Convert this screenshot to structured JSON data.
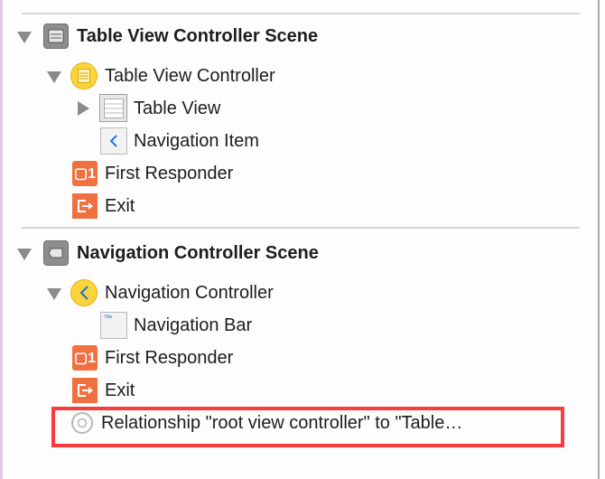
{
  "outline": {
    "scenes": [
      {
        "title": "Table View Controller Scene",
        "items": [
          {
            "label": "Table View Controller",
            "icon": "table-view-controller-icon"
          },
          {
            "label": "Table View",
            "icon": "table-view-icon"
          },
          {
            "label": "Navigation Item",
            "icon": "navigation-item-icon"
          },
          {
            "label": "First Responder",
            "icon": "first-responder-icon"
          },
          {
            "label": "Exit",
            "icon": "exit-icon"
          }
        ]
      },
      {
        "title": "Navigation Controller Scene",
        "items": [
          {
            "label": "Navigation Controller",
            "icon": "navigation-controller-icon"
          },
          {
            "label": "Navigation Bar",
            "icon": "navigation-bar-icon",
            "icon_text": "Title"
          },
          {
            "label": "First Responder",
            "icon": "first-responder-icon"
          },
          {
            "label": "Exit",
            "icon": "exit-icon"
          },
          {
            "label": "Relationship \"root view controller\" to \"Table…",
            "icon": "relationship-icon"
          }
        ]
      }
    ]
  },
  "colors": {
    "highlight": "#fb3c3c",
    "controller": "#fdd33a",
    "responder": "#f0703f",
    "nav_blue": "#1f6fe0"
  }
}
